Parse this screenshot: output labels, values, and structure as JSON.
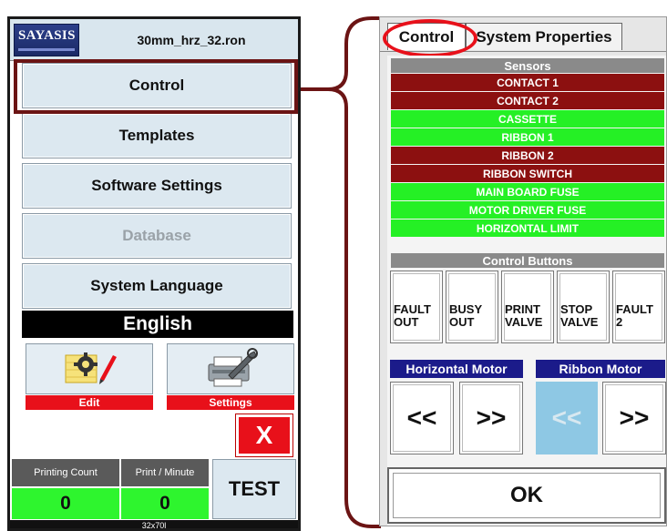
{
  "main_window": {
    "logo_text": "SAYASIS",
    "file_name": "30mm_hrz_32.ron",
    "menu": {
      "control": "Control",
      "templates": "Templates",
      "software_settings": "Software Settings",
      "database": "Database",
      "system_language": "System Language"
    },
    "language_value": "English",
    "edit_label": "Edit",
    "settings_label": "Settings",
    "close_label": "X",
    "printing_count_label": "Printing Count",
    "printing_count_value": "0",
    "print_per_minute_label": "Print / Minute",
    "print_per_minute_value": "0",
    "test_label": "TEST",
    "status_text": "32x70l",
    "icons": {
      "edit": "gear-pencil-icon",
      "settings": "wrench-printer-icon"
    }
  },
  "control_window": {
    "tabs": [
      {
        "label": "Control",
        "active": true
      },
      {
        "label": "System Properties",
        "active": false
      }
    ],
    "sensors_title": "Sensors",
    "sensors": [
      {
        "label": "CONTACT 1",
        "state": "off"
      },
      {
        "label": "CONTACT 2",
        "state": "off"
      },
      {
        "label": "CASSETTE",
        "state": "on"
      },
      {
        "label": "RIBBON 1",
        "state": "on"
      },
      {
        "label": "RIBBON 2",
        "state": "off"
      },
      {
        "label": "RIBBON SWITCH",
        "state": "off"
      },
      {
        "label": "MAIN BOARD FUSE",
        "state": "on"
      },
      {
        "label": "MOTOR DRIVER FUSE",
        "state": "on"
      },
      {
        "label": "HORIZONTAL LIMIT",
        "state": "on"
      }
    ],
    "control_buttons_title": "Control Buttons",
    "control_buttons": [
      {
        "label": "FAULT\nOUT"
      },
      {
        "label": "BUSY\nOUT"
      },
      {
        "label": "PRINT\nVALVE"
      },
      {
        "label": "STOP\nVALVE"
      },
      {
        "label": "FAULT\n2"
      }
    ],
    "horizontal_motor_title": "Horizontal Motor",
    "ribbon_motor_title": "Ribbon Motor",
    "horizontal_motor_buttons": [
      "<<",
      ">>"
    ],
    "ribbon_motor_buttons": [
      "<<",
      ">>"
    ],
    "ribbon_motor_left_enabled": false,
    "ok_label": "OK"
  },
  "colors": {
    "sensor_off": "#8c1010",
    "sensor_on": "#25f025",
    "highlight_red": "#e8101a",
    "brace_color": "#6b1414",
    "motor_header": "#1b1b8a"
  }
}
